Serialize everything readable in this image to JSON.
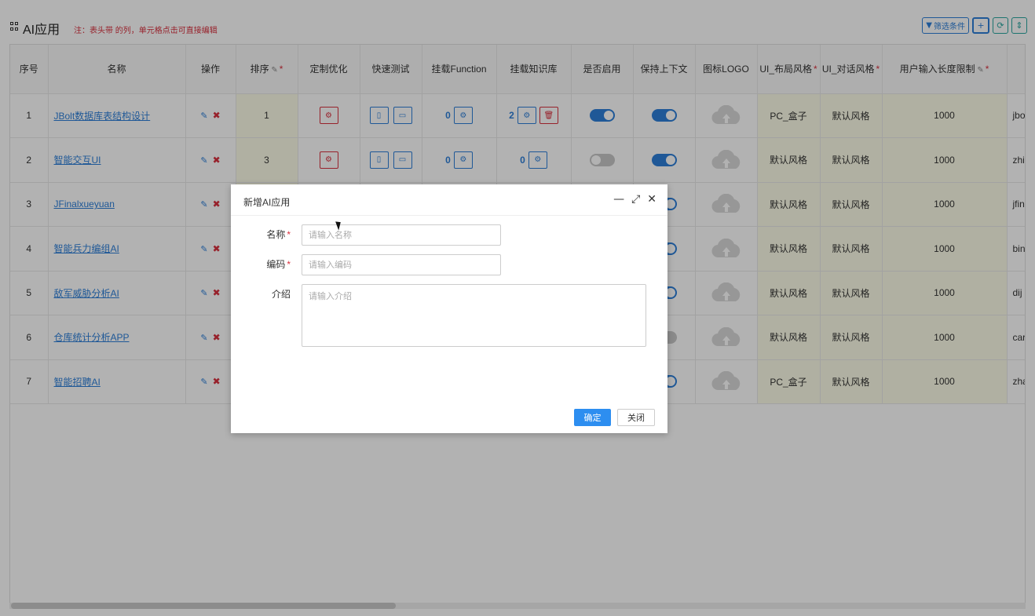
{
  "page": {
    "title": "AI应用",
    "note": "注：表头带 的列，单元格点击可直接编辑"
  },
  "toolbar": {
    "filter_label": "筛选条件",
    "add_glyph": "+",
    "refresh_glyph": "⟳",
    "sort_glyph": "⇕"
  },
  "table": {
    "headers": [
      "序号",
      "名称",
      "操作",
      "排序",
      "定制优化",
      "快速测试",
      "挂载Function",
      "挂载知识库",
      "是否启用",
      "保持上下文",
      "图标LOGO",
      "UI_布局风格",
      "UI_对话风格",
      "用户输入长度限制",
      ""
    ],
    "rows": [
      {
        "index": "1",
        "name": "JBolt数据库表结构设计",
        "sort": "1",
        "func_count": "0",
        "kb_count": "2",
        "enabled": true,
        "keep_context": true,
        "layout": "PC_盒子",
        "dialog": "默认风格",
        "limit": "1000",
        "code": "jbo"
      },
      {
        "index": "2",
        "name": "智能交互UI",
        "sort": "3",
        "func_count": "0",
        "kb_count": "0",
        "enabled": false,
        "keep_context": true,
        "layout": "默认风格",
        "dialog": "默认风格",
        "limit": "1000",
        "code": "zhi"
      },
      {
        "index": "3",
        "name": "JFinalxueyuan",
        "sort": "",
        "func_count": "",
        "kb_count": "",
        "enabled": false,
        "keep_context": true,
        "layout": "默认风格",
        "dialog": "默认风格",
        "limit": "1000",
        "code": "jfin"
      },
      {
        "index": "4",
        "name": "智能兵力编组AI",
        "sort": "",
        "func_count": "",
        "kb_count": "",
        "enabled": false,
        "keep_context": true,
        "layout": "默认风格",
        "dialog": "默认风格",
        "limit": "1000",
        "code": "bin"
      },
      {
        "index": "5",
        "name": "敌军威胁分析AI",
        "sort": "",
        "func_count": "",
        "kb_count": "",
        "enabled": false,
        "keep_context": true,
        "layout": "默认风格",
        "dialog": "默认风格",
        "limit": "1000",
        "code": "dij"
      },
      {
        "index": "6",
        "name": "仓库统计分析APP",
        "sort": "",
        "func_count": "",
        "kb_count": "",
        "enabled": false,
        "keep_context": false,
        "layout": "默认风格",
        "dialog": "默认风格",
        "limit": "1000",
        "code": "car"
      },
      {
        "index": "7",
        "name": "智能招聘AI",
        "sort": "",
        "func_count": "",
        "kb_count": "",
        "enabled": false,
        "keep_context": true,
        "layout": "PC_盒子",
        "dialog": "默认风格",
        "limit": "1000",
        "code": "zha"
      }
    ]
  },
  "dialog": {
    "title": "新增AI应用",
    "name_label": "名称",
    "name_placeholder": "请输入名称",
    "code_label": "编码",
    "code_placeholder": "请输入编码",
    "intro_label": "介绍",
    "intro_placeholder": "请输入介绍",
    "ok_label": "确定",
    "close_label": "关闭"
  },
  "colors": {
    "accent": "#2d7fd8",
    "danger": "#d9303e",
    "editable_cell": "#fdfde8"
  }
}
